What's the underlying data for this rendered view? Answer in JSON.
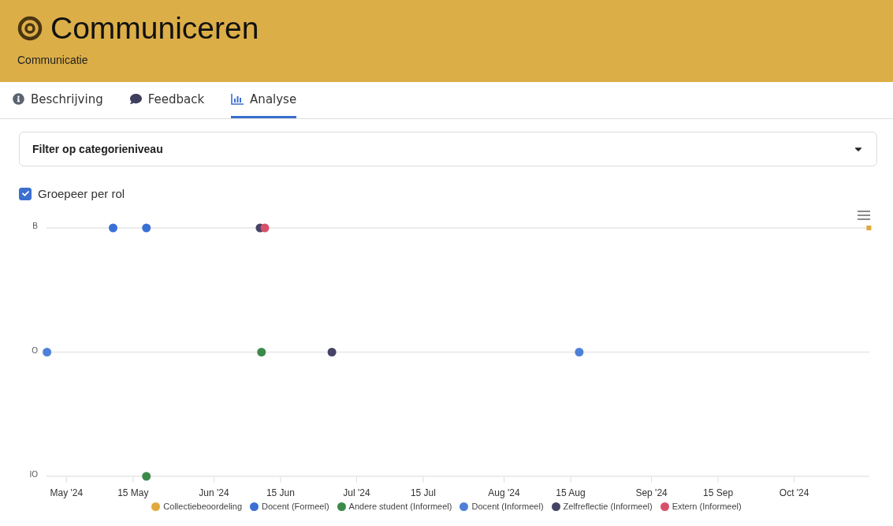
{
  "header": {
    "title": "Communiceren",
    "subtitle": "Communicatie"
  },
  "tabs": [
    {
      "label": "Beschrijving",
      "kind": "info",
      "selected": false
    },
    {
      "label": "Feedback",
      "kind": "comment",
      "selected": false
    },
    {
      "label": "Analyse",
      "kind": "chart",
      "selected": true
    }
  ],
  "filter": {
    "value": "Filter op categorieniveau"
  },
  "group_by_role": {
    "label": "Groepeer per rol",
    "checked": true
  },
  "chart": {
    "y_labels": [
      "B",
      "O",
      "IO"
    ],
    "x_labels": [
      "May '24",
      "15 May",
      "Jun '24",
      "15 Jun",
      "Jul '24",
      "15 Jul",
      "Aug '24",
      "15 Aug",
      "Sep '24",
      "15 Sep",
      "Oct '24"
    ],
    "legend": [
      {
        "name": "Collectiebeoordeling",
        "color": "#e0a93b"
      },
      {
        "name": "Docent (Formeel)",
        "color": "#3a6fd6"
      },
      {
        "name": "Andere student (Informeel)",
        "color": "#3c8a4a"
      },
      {
        "name": "Docent (Informeel)",
        "color": "#4f80d9"
      },
      {
        "name": "Zelfreflectie (Informeel)",
        "color": "#454466"
      },
      {
        "name": "Extern (Informeel)",
        "color": "#d9506a"
      }
    ]
  }
}
